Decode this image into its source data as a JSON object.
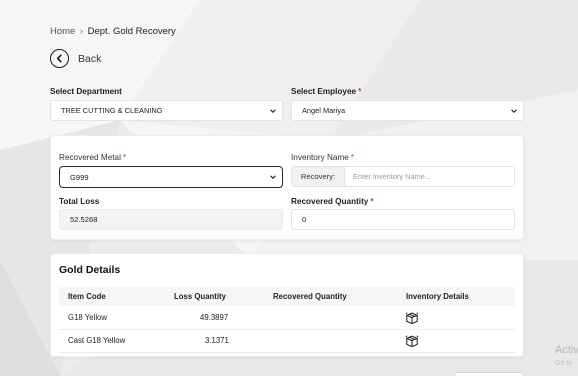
{
  "breadcrumb": {
    "home": "Home",
    "current": "Dept. Gold Recovery"
  },
  "back_label": "Back",
  "department": {
    "label": "Select Department",
    "value": "TREE CUTTING & CLEANING"
  },
  "employee": {
    "label": "Select Employee",
    "value": "Angel Mariya"
  },
  "form": {
    "metal_label": "Recovered Metal",
    "metal_value": "G999",
    "inventory_label": "Inventory Name",
    "inventory_prefix": "Recovery:",
    "inventory_placeholder": "Enter Inventory Name...",
    "total_loss_label": "Total Loss",
    "total_loss_value": "52.5268",
    "recovered_qty_label": "Recovered Quantity",
    "recovered_qty_value": "0"
  },
  "gold_details": {
    "title": "Gold Details",
    "columns": [
      "Item Code",
      "Loss Quantity",
      "Recovered Quantity",
      "Inventory Details"
    ],
    "rows": [
      {
        "item_code": "G18 Yellow",
        "loss_quantity": "49.3897",
        "recovered_quantity": "",
        "inventory_icon": "package-icon"
      },
      {
        "item_code": "Cast G18 Yellow",
        "loss_quantity": "3.1371",
        "recovered_quantity": "",
        "inventory_icon": "package-icon"
      }
    ]
  },
  "watermark": {
    "line1": "Activ",
    "line2": "Go to"
  },
  "colors": {
    "required": "#dd3333",
    "border": "#e2e2e2",
    "focus_border": "#2a2a2a"
  }
}
